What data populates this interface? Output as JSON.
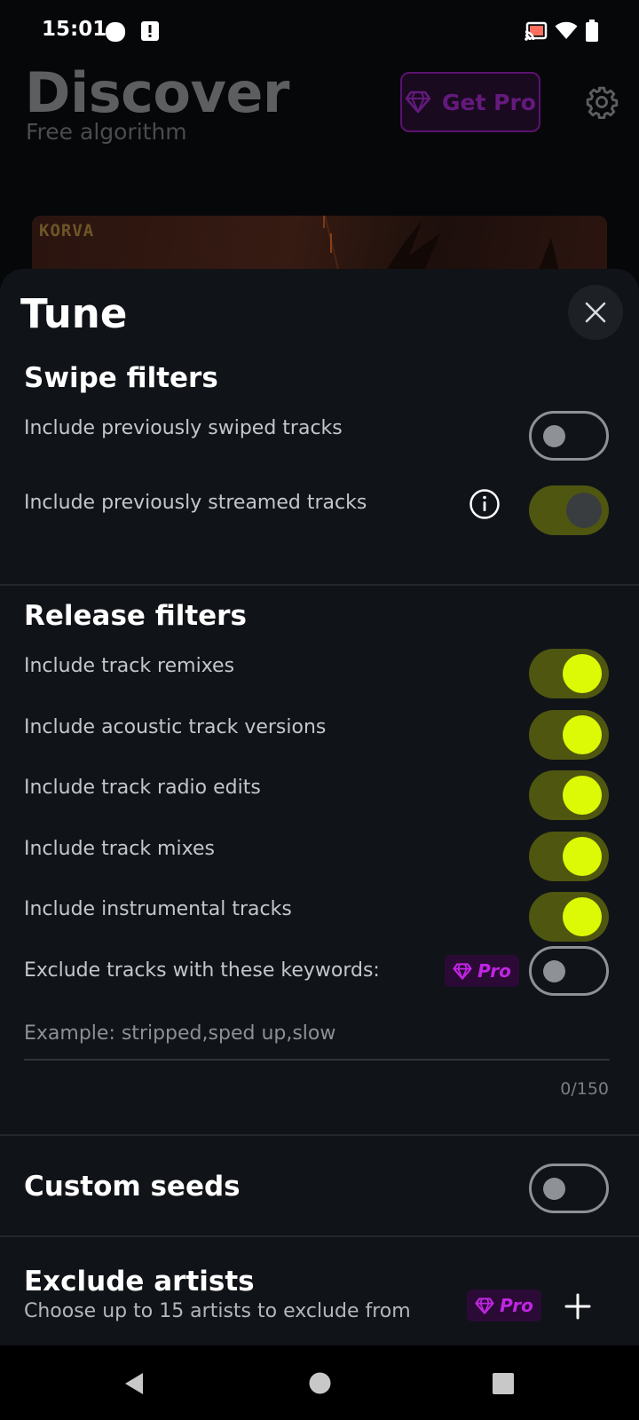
{
  "status_bar": {
    "time": "15:01",
    "icons": [
      "circle-notification-icon",
      "alert-notification-icon",
      "cast-icon",
      "wifi-icon",
      "battery-icon"
    ]
  },
  "background": {
    "title": "Discover",
    "subtitle": "Free algorithm",
    "get_pro_label": "Get Pro",
    "card_label": "KORVA"
  },
  "sheet": {
    "title": "Tune",
    "swipe_filters": {
      "title": "Swipe filters",
      "rows": [
        {
          "label": "Include previously swiped tracks",
          "state": "off"
        },
        {
          "label": "Include previously streamed tracks",
          "state": "on-disabled"
        }
      ]
    },
    "release_filters": {
      "title": "Release filters",
      "rows": [
        {
          "label": "Include track remixes",
          "state": "on"
        },
        {
          "label": "Include acoustic track versions",
          "state": "on"
        },
        {
          "label": "Include track radio edits",
          "state": "on"
        },
        {
          "label": "Include track mixes",
          "state": "on"
        },
        {
          "label": "Include instrumental tracks",
          "state": "on"
        }
      ],
      "keywords": {
        "label": "Exclude tracks with these keywords:",
        "pro_label": "Pro",
        "state": "off",
        "placeholder": "Example: stripped,sped up,slow",
        "value": "",
        "counter": "0/150"
      }
    },
    "custom_seeds": {
      "title": "Custom seeds",
      "state": "off"
    },
    "exclude_artists": {
      "title": "Exclude artists",
      "description": "Choose up to 15 artists to exclude from",
      "pro_label": "Pro"
    }
  },
  "colors": {
    "accent_lime": "#dcfa05",
    "toggle_track_on": "#4f5610",
    "pro_purple": "#c125e4",
    "sheet_bg": "#101318"
  }
}
